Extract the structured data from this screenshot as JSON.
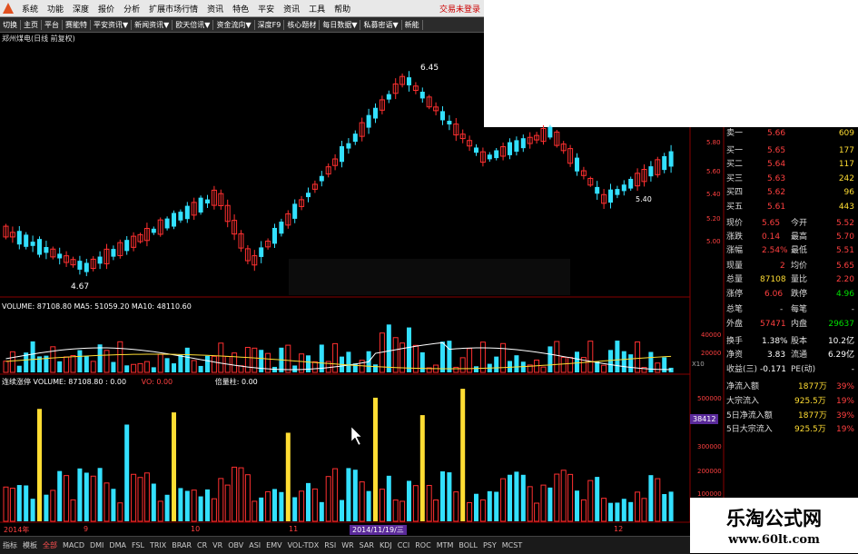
{
  "menubar": {
    "items": [
      "系统",
      "功能",
      "深度",
      "报价",
      "分析",
      "扩展市场行情",
      "资讯",
      "特色",
      "平安",
      "资讯",
      "工具",
      "帮助"
    ],
    "login_status": "交易未登录"
  },
  "toolbar": {
    "items": [
      "切换",
      "主页",
      "平台",
      "赛能特",
      "平安资讯▼",
      "新闻资讯▼",
      "欧天倍讯▼",
      "资金流向▼",
      "深度F9",
      "核心题材",
      "每日数据▼",
      "私募密语▼",
      "新能"
    ]
  },
  "chart": {
    "title": "郑州煤电(日线 前复权)",
    "high_label": "6.45",
    "low_label": "4.67",
    "low2_label": "5.40"
  },
  "volume": {
    "header": "VOLUME: 87108.80  MA5: 51059.20  MA10: 48110.60",
    "axis": [
      "40000",
      "20000"
    ],
    "unit": "X10"
  },
  "indicator": {
    "name": "连续涨停",
    "header": "VOLUME: 87108.80 : 0.00",
    "vol": "VO: 0.00",
    "extra": "倍量柱: 0.00",
    "axis": [
      "500000",
      "400000",
      "300000",
      "200000",
      "100000"
    ],
    "price_tag": "38412"
  },
  "price_axis": [
    "5.80",
    "5.60",
    "5.40",
    "5.20",
    "5.00"
  ],
  "quote_panel": {
    "sell": [
      {
        "label": "卖一",
        "price": "5.66",
        "vol": "609"
      }
    ],
    "buy": [
      {
        "label": "买一",
        "price": "5.65",
        "vol": "177"
      },
      {
        "label": "买二",
        "price": "5.64",
        "vol": "117"
      },
      {
        "label": "买三",
        "price": "5.63",
        "vol": "242"
      },
      {
        "label": "买四",
        "price": "5.62",
        "vol": "96"
      },
      {
        "label": "买五",
        "price": "5.61",
        "vol": "443"
      }
    ],
    "stats": [
      {
        "l1": "现价",
        "v1": "5.65",
        "l2": "今开",
        "v2": "5.52"
      },
      {
        "l1": "涨跌",
        "v1": "0.14",
        "l2": "最高",
        "v2": "5.70"
      },
      {
        "l1": "涨幅",
        "v1": "2.54%",
        "l2": "最低",
        "v2": "5.51"
      },
      {
        "l1": "现量",
        "v1": "2",
        "l2": "均价",
        "v2": "5.65"
      },
      {
        "l1": "总量",
        "v1": "87108",
        "l2": "量比",
        "v2": "2.20"
      },
      {
        "l1": "涨停",
        "v1": "6.06",
        "l2": "跌停",
        "v2": "4.96"
      },
      {
        "l1": "总笔",
        "v1": "-",
        "l2": "每笔",
        "v2": "-"
      },
      {
        "l1": "外盘",
        "v1": "57471",
        "l2": "内盘",
        "v2": "29637"
      }
    ],
    "fin": [
      {
        "l1": "换手",
        "v1": "1.38%",
        "l2": "股本",
        "v2": "10.2亿"
      },
      {
        "l1": "净资",
        "v1": "3.83",
        "l2": "流通",
        "v2": "6.29亿"
      },
      {
        "l1": "收益(三)",
        "v1": "-0.171",
        "l2": "PE(动)",
        "v2": "-"
      }
    ],
    "flow": [
      {
        "label": "净流入额",
        "value": "1877万",
        "pct": "39%"
      },
      {
        "label": "大宗流入",
        "value": "925.5万",
        "pct": "19%"
      },
      {
        "label": "5日净流入额",
        "value": "1877万",
        "pct": "39%"
      },
      {
        "label": "5日大宗流入",
        "value": "925.5万",
        "pct": "19%"
      }
    ]
  },
  "time_axis": [
    "2014年",
    "9",
    "10",
    "11",
    "12"
  ],
  "cursor_date": "2014/11/19/三",
  "bottombar": {
    "items": [
      "指标",
      "模板",
      "全部",
      "MACD",
      "DMI",
      "DMA",
      "FSL",
      "TRIX",
      "BRAR",
      "CR",
      "VR",
      "OBV",
      "ASI",
      "EMV",
      "VOL-TDX",
      "RSI",
      "WR",
      "SAR",
      "KDJ",
      "CCI",
      "ROC",
      "MTM",
      "BOLL",
      "PSY",
      "MCST"
    ]
  },
  "watermark": {
    "line1": "乐淘公式网",
    "line2": "www.60lt.com"
  },
  "colors": {
    "up": "#ff3030",
    "down": "#33e0ff",
    "bg": "#000000",
    "ma5": "#ffffff",
    "ma10": "#ffdd33",
    "limit": "#ffdd33"
  }
}
